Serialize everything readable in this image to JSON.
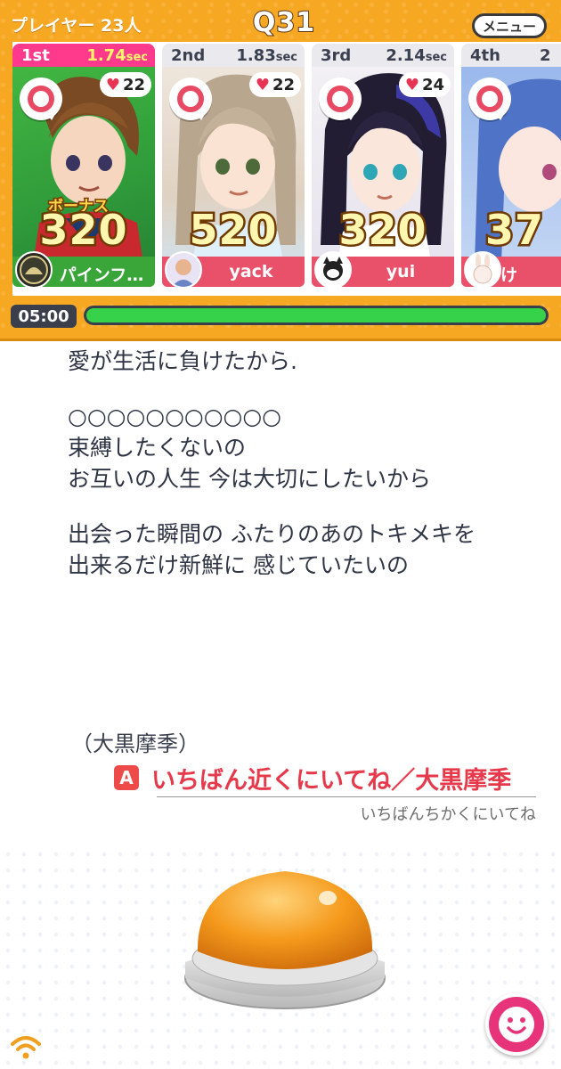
{
  "header": {
    "player_count": "プレイヤー 23人",
    "question_no": "Q31",
    "menu_label": "メニュー"
  },
  "players": [
    {
      "rank": "1st",
      "time": "1.74",
      "unit": "sec",
      "hearts": "22",
      "bonus": "ボーナス",
      "score": "320",
      "name": "パインフ…",
      "colors": {
        "art": "#34a34a"
      }
    },
    {
      "rank": "2nd",
      "time": "1.83",
      "unit": "sec",
      "hearts": "22",
      "bonus": "",
      "score": "520",
      "name": "yack",
      "colors": {
        "art": "#d9c9b8"
      }
    },
    {
      "rank": "3rd",
      "time": "2.14",
      "unit": "sec",
      "hearts": "24",
      "bonus": "",
      "score": "320",
      "name": "yui",
      "colors": {
        "art": "#3a2f5c"
      }
    },
    {
      "rank": "4th",
      "time": "2",
      "unit": "",
      "hearts": "",
      "bonus": "",
      "score": "37",
      "name": "け",
      "colors": {
        "art": "#6b8fd4"
      }
    }
  ],
  "timer": {
    "label": "05:00",
    "progress": 1.0
  },
  "lyrics": {
    "lines": [
      "愛が生活に負けたから.",
      "",
      "○○○○○○○○○○○",
      "束縛したくないの",
      "お互いの人生 今は大切にしたいから",
      "",
      "出会った瞬間の ふたりのあのトキメキを",
      "出来るだけ新鮮に 感じていたいの"
    ]
  },
  "answer": {
    "artist_credit": "（大黒摩季）",
    "badge": "A",
    "title": "いちばん近くにいてね／大黒摩季",
    "reading": "いちばんちかくにいてね"
  },
  "icons": {
    "wifi": "wifi-icon",
    "emote": "smile-icon",
    "buzzer": "buzzer-button"
  },
  "colors": {
    "panel": "#f7a823",
    "accent_pink": "#ff3a8d",
    "answer_red": "#e6394b",
    "progress_green": "#36d24a"
  }
}
